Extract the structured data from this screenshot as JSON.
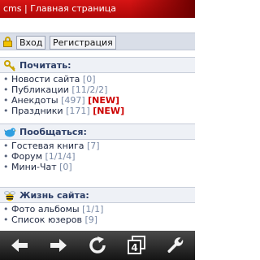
{
  "titlebar": {
    "title": "cms | Главная страница"
  },
  "auth": {
    "login_label": "Вход",
    "register_label": "Регистрация"
  },
  "sections": [
    {
      "title": "Почитать:",
      "items": [
        {
          "label": "Новости сайта",
          "count": "[0]",
          "badge": ""
        },
        {
          "label": "Публикации",
          "count": "[11/2/2]",
          "badge": ""
        },
        {
          "label": "Анекдоты",
          "count": "[497]",
          "badge": "[NEW]"
        },
        {
          "label": "Праздники",
          "count": "[171]",
          "badge": "[NEW]"
        }
      ]
    },
    {
      "title": "Пообщаться:",
      "items": [
        {
          "label": "Гостевая книга",
          "count": "[7]",
          "badge": ""
        },
        {
          "label": "Форум",
          "count": "[1/1/4]",
          "badge": ""
        },
        {
          "label": "Мини-Чат",
          "count": "[0]",
          "badge": ""
        }
      ]
    },
    {
      "title": "Жизнь сайта:",
      "items": [
        {
          "label": "Фото альбомы",
          "count": "[1/1]",
          "badge": ""
        },
        {
          "label": "Список юзеров",
          "count": "[9]",
          "badge": ""
        }
      ]
    }
  ],
  "toolbar": {
    "tabs_count": "4"
  },
  "colors": {
    "titlebar": "#c40d0d",
    "section_title": "#2c3e66",
    "new_badge": "#cc0000",
    "toolbar": "#2a2a2a"
  },
  "icons": {
    "section1": "key-icon",
    "section2": "bird-icon",
    "section3": "bee-icon",
    "toolbar": [
      "back-arrow-icon",
      "forward-arrow-icon",
      "reload-icon",
      "tabs-icon",
      "wrench-icon"
    ]
  }
}
